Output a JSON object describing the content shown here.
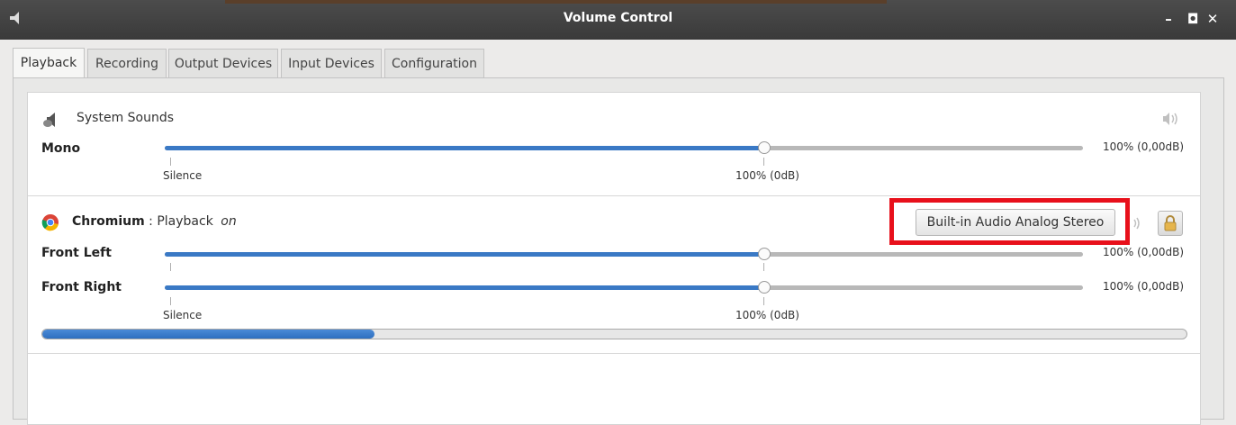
{
  "window": {
    "title": "Volume Control",
    "controls": [
      "–",
      "◘",
      "✕"
    ]
  },
  "tabs": [
    {
      "label": "Playback",
      "active": true
    },
    {
      "label": "Recording"
    },
    {
      "label": "Output Devices"
    },
    {
      "label": "Input Devices"
    },
    {
      "label": "Configuration"
    }
  ],
  "system_sounds": {
    "name": "System Sounds",
    "icon": "speaker-icon",
    "mute_icon": "volume-icon",
    "channel": "Mono",
    "level_pct": 100,
    "value_text": "100% (0,00dB)",
    "scale_silence": "Silence",
    "scale_100": "100% (0dB)"
  },
  "chromium": {
    "name": "Chromium",
    "separator": " : ",
    "stream": "Playback",
    "state": "on",
    "icon": "chromium-icon",
    "device_button": "Built-in Audio Analog Stereo",
    "mute_icon": "volume-icon",
    "lock_icon": "lock-icon",
    "channels": [
      {
        "label": "Front Left",
        "level_pct": 100,
        "value_text": "100% (0,00dB)"
      },
      {
        "label": "Front Right",
        "level_pct": 100,
        "value_text": "100% (0,00dB)"
      }
    ],
    "scale_silence": "Silence",
    "scale_100": "100% (0dB)",
    "peak_level_fraction": 0.29
  },
  "colors": {
    "accent": "#3a79c5",
    "highlight": "#e8101b",
    "titlebar": "#444444"
  }
}
